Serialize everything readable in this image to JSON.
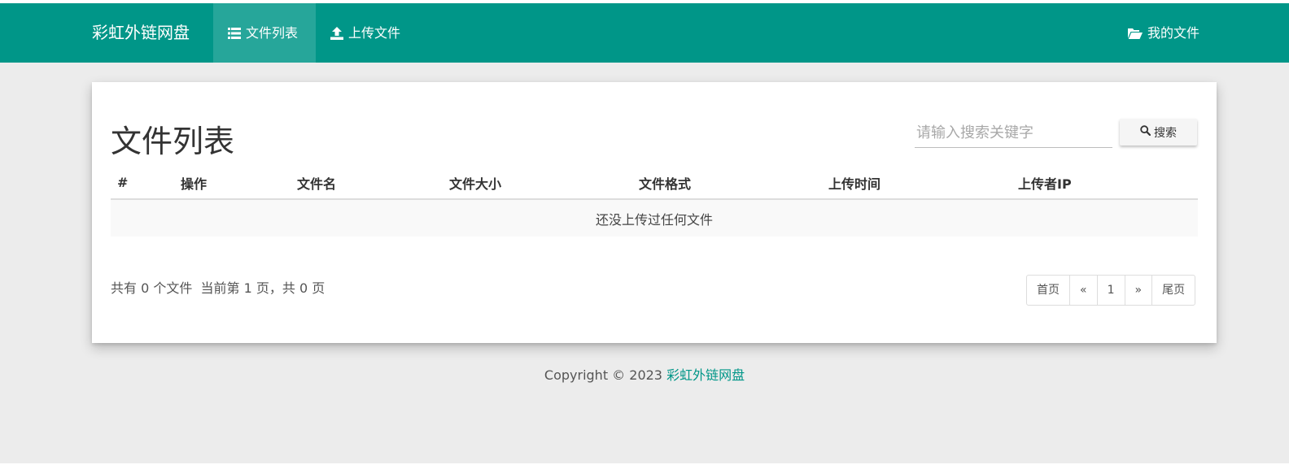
{
  "nav": {
    "brand": "彩虹外链网盘",
    "items": [
      {
        "label": "文件列表",
        "icon": "list-icon"
      },
      {
        "label": "上传文件",
        "icon": "upload-icon"
      }
    ],
    "right_item": {
      "label": "我的文件",
      "icon": "folder-open-icon"
    }
  },
  "colors": {
    "primary": "#009688",
    "active": "#26a69a",
    "background": "#ececec"
  },
  "main": {
    "title": "文件列表",
    "search": {
      "placeholder": "请输入搜索关键字",
      "value": "",
      "button_label": "搜索"
    },
    "table": {
      "columns": [
        "#",
        "操作",
        "文件名",
        "文件大小",
        "文件格式",
        "上传时间",
        "上传者IP"
      ],
      "rows": [],
      "empty_text": "还没上传过任何文件"
    },
    "summary": "共有 0 个文件  当前第 1 页，共 0 页",
    "pagination": {
      "first": "首页",
      "prev": "«",
      "current": "1",
      "next": "»",
      "last": "尾页"
    }
  },
  "footer": {
    "copyright": "Copyright © 2023 ",
    "site_name": "彩虹外链网盘"
  }
}
